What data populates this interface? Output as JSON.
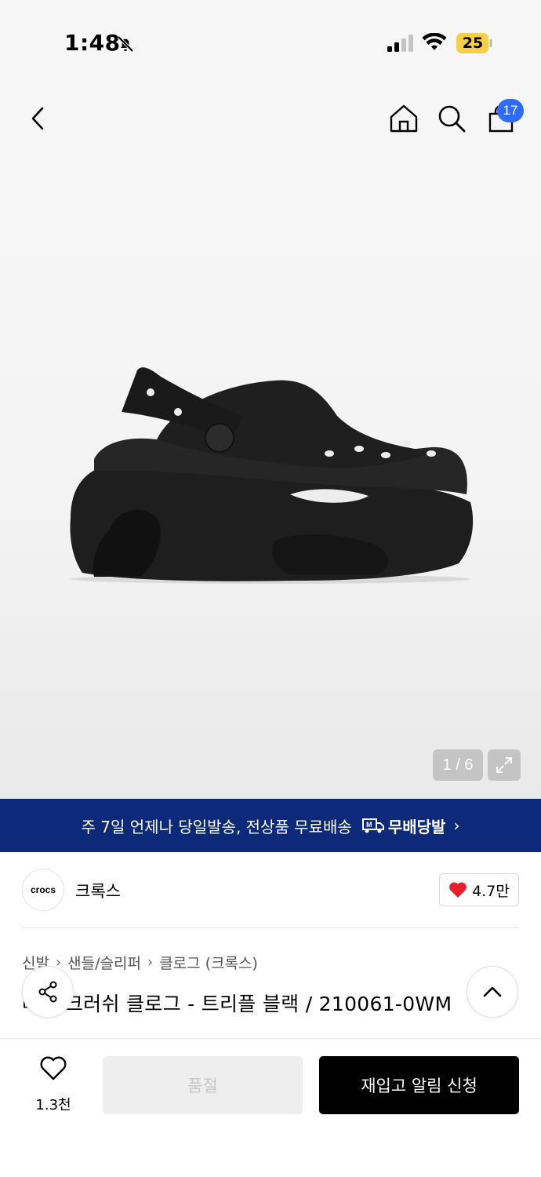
{
  "status_bar": {
    "time": "1:48",
    "battery": "25",
    "icons": [
      "bell-off-icon",
      "signal-icon",
      "wifi-icon",
      "battery-icon"
    ]
  },
  "nav": {
    "icons": [
      "chevron-left-icon",
      "home-icon",
      "search-icon",
      "shopping-bag-icon"
    ],
    "cart_count": "17"
  },
  "gallery": {
    "counter": "1 / 6"
  },
  "banner": {
    "text": "주 7일 언제나 당일발송, 전상품 무료배송",
    "service_name": "무배당발",
    "chevron": "›"
  },
  "brand": {
    "logo_text": "crocs",
    "name": "크록스",
    "likes": "4.7만"
  },
  "breadcrumb": [
    "신발",
    "샌들/슬리퍼",
    "클로그 (크록스)"
  ],
  "product": {
    "title": "베이 크러쉬 클로그 - 트리플 블랙 / 210061-0WM"
  },
  "bottom_bar": {
    "wish_count": "1.3천",
    "soldout_label": "품절",
    "restock_label": "재입고 알림 신청"
  },
  "colors": {
    "banner_bg": "#0d2a7a",
    "badge_bg": "#2f6bff",
    "heart": "#e8202c",
    "primary_button": "#000000"
  }
}
